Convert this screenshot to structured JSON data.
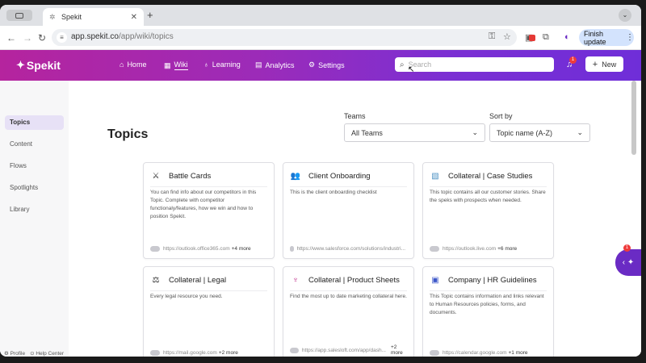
{
  "browser": {
    "tab_title": "Spekit",
    "url_host": "app.spekit.co",
    "url_path": "/app/wiki/topics",
    "finish_update_label": "Finish update"
  },
  "header": {
    "logo": "Spekit",
    "nav": [
      {
        "label": "Home",
        "icon": "home-icon"
      },
      {
        "label": "Wiki",
        "icon": "grid-icon",
        "active": true
      },
      {
        "label": "Learning",
        "icon": "lightbulb-icon"
      },
      {
        "label": "Analytics",
        "icon": "chart-icon"
      },
      {
        "label": "Settings",
        "icon": "gear-icon"
      }
    ],
    "search_placeholder": "Search",
    "notification_count": "1",
    "new_button_label": "New"
  },
  "sidebar": {
    "items": [
      {
        "label": "Topics",
        "active": true
      },
      {
        "label": "Content"
      },
      {
        "label": "Flows"
      },
      {
        "label": "Spotlights"
      },
      {
        "label": "Library"
      }
    ],
    "footer": {
      "profile": "Profile",
      "help": "Help Center"
    }
  },
  "main": {
    "title": "Topics",
    "teams_label": "Teams",
    "teams_value": "All Teams",
    "sort_label": "Sort by",
    "sort_value": "Topic name (A-Z)",
    "cards": [
      {
        "title": "Battle Cards",
        "icon": "swords-icon",
        "desc": "You can find info about our competitors in this Topic. Complete with competitor functionaly/features, how we win and how to position Spekit.",
        "link": "https://outlook.office365.com",
        "more": "+4 more"
      },
      {
        "title": "Client Onboarding",
        "icon": "people-icon",
        "desc": "This is the client onboarding checklist",
        "link": "https://www.salesforce.com/solutions/industri...",
        "more": ""
      },
      {
        "title": "Collateral | Case Studies",
        "icon": "document-image-icon",
        "desc": "This topic contains all our customer stories. Share the speks with prospects when needed.",
        "link": "https://outlook.live.com",
        "more": "+6 more"
      },
      {
        "title": "Collateral | Legal",
        "icon": "scales-icon",
        "desc": "Every legal resource you need.",
        "link": "https://mail.google.com",
        "more": "+2 more"
      },
      {
        "title": "Collateral | Product Sheets",
        "icon": "octopus-icon",
        "desc": "Find the most up to date marketing collateral here.",
        "link": "https://app.salesloft.com/app/dash...",
        "more": "+2 more"
      },
      {
        "title": "Company | HR Guidelines",
        "icon": "id-card-icon",
        "desc": "This Topic contains information and links relevant to Human Resources policies, forms, and documents.",
        "link": "https://calendar.google.com",
        "more": "+1 more"
      }
    ]
  },
  "widget_badge": "1",
  "colors": {
    "header_start": "#b5249e",
    "header_end": "#6f2ed8",
    "accent": "#6a2bc4",
    "active_side_bg": "#e7e1f6"
  }
}
